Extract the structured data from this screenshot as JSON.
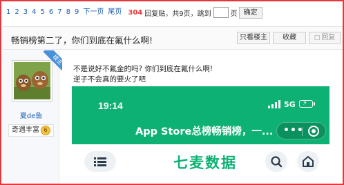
{
  "pager": {
    "pages": [
      "1",
      "2",
      "3",
      "4",
      "5",
      "6",
      "7",
      "8",
      "9"
    ],
    "next_label": "下一页",
    "last_label": "尾页",
    "reply_count": "304",
    "reply_suffix": "回复贴，共9页，跳到",
    "page_unit": "页",
    "go_label": "确定"
  },
  "thread": {
    "title": "畅销榜第二了，你们到底在氟什么啊!",
    "only_author": "只看楼主",
    "favorite": "收藏",
    "reply": "回复"
  },
  "user": {
    "name": "夏de鱼",
    "rank": "奇遇丰富",
    "medal": "6",
    "floor": "楼主"
  },
  "post": {
    "line1": "不是说好不氟金的吗? 你们到底在氟什么啊!",
    "line2": "逆子不会真的要火了吧"
  },
  "phone": {
    "time": "19:14",
    "network": "5G",
    "title": "App Store总榜畅销榜，一...",
    "brand": "七麦数据"
  },
  "colors": {
    "frame": "#e4393c",
    "link": "#1a5fb4",
    "phone_green": "#0eb174"
  }
}
